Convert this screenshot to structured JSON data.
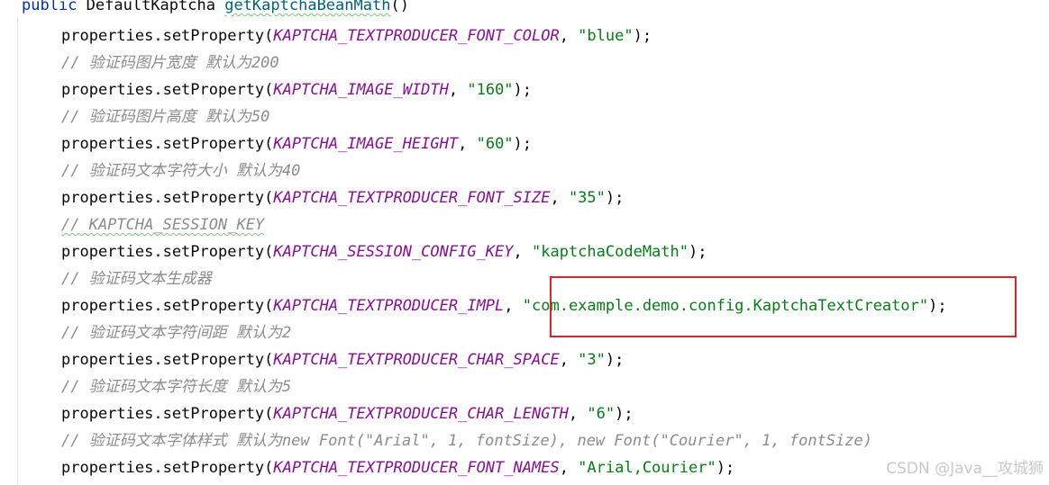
{
  "header": {
    "kw": "public",
    "type": "DefaultKaptcha",
    "method": "getKaptchaBeanMath",
    "parens": "()"
  },
  "lines": [
    {
      "type": "call",
      "obj": "properties.setProperty(",
      "const": "KAPTCHA_TEXTPRODUCER_FONT_COLOR",
      "sep": ", ",
      "str": "\"blue\"",
      "end": ");"
    },
    {
      "type": "comment",
      "text": "// 验证码图片宽度 默认为200"
    },
    {
      "type": "call",
      "obj": "properties.setProperty(",
      "const": "KAPTCHA_IMAGE_WIDTH",
      "sep": ", ",
      "str": "\"160\"",
      "end": ");"
    },
    {
      "type": "comment",
      "text": "// 验证码图片高度 默认为50"
    },
    {
      "type": "call",
      "obj": "properties.setProperty(",
      "const": "KAPTCHA_IMAGE_HEIGHT",
      "sep": ", ",
      "str": "\"60\"",
      "end": ");"
    },
    {
      "type": "comment",
      "text": "// 验证码文本字符大小 默认为40"
    },
    {
      "type": "call",
      "obj": "properties.setProperty(",
      "const": "KAPTCHA_TEXTPRODUCER_FONT_SIZE",
      "sep": ", ",
      "str": "\"35\"",
      "end": ");"
    },
    {
      "type": "comment",
      "text": "// KAPTCHA_SESSION_KEY"
    },
    {
      "type": "call",
      "obj": "properties.setProperty(",
      "const": "KAPTCHA_SESSION_CONFIG_KEY",
      "sep": ", ",
      "str": "\"kaptchaCodeMath\"",
      "end": ");"
    },
    {
      "type": "comment",
      "text": "// 验证码文本生成器"
    },
    {
      "type": "call",
      "obj": "properties.setProperty(",
      "const": "KAPTCHA_TEXTPRODUCER_IMPL",
      "sep": ", ",
      "str": "\"com.example.demo.config.KaptchaTextCreator\"",
      "end": ");"
    },
    {
      "type": "comment",
      "text": "// 验证码文本字符间距 默认为2"
    },
    {
      "type": "call",
      "obj": "properties.setProperty(",
      "const": "KAPTCHA_TEXTPRODUCER_CHAR_SPACE",
      "sep": ", ",
      "str": "\"3\"",
      "end": ");"
    },
    {
      "type": "comment",
      "text": "// 验证码文本字符长度 默认为5"
    },
    {
      "type": "call",
      "obj": "properties.setProperty(",
      "const": "KAPTCHA_TEXTPRODUCER_CHAR_LENGTH",
      "sep": ", ",
      "str": "\"6\"",
      "end": ");"
    },
    {
      "type": "comment",
      "text": "// 验证码文本字体样式 默认为new Font(\"Arial\", 1, fontSize), new Font(\"Courier\", 1, fontSize)"
    },
    {
      "type": "call",
      "obj": "properties.setProperty(",
      "const": "KAPTCHA_TEXTPRODUCER_FONT_NAMES",
      "sep": ", ",
      "str": "\"Arial,Courier\"",
      "end": ");"
    }
  ],
  "watermark": "CSDN @Java__攻城狮",
  "colors": {
    "keyword": "#0033b3",
    "method": "#00627a",
    "constant": "#871094",
    "string": "#067d17",
    "comment": "#8c8c8c",
    "highlight_border": "#d9262c"
  }
}
